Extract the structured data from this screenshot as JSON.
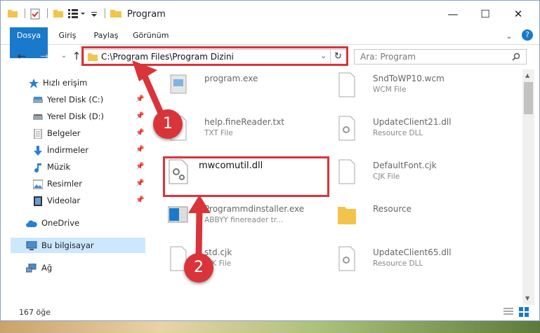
{
  "window": {
    "title": "Program",
    "controls": {
      "minimize": "—",
      "maximize": "☐",
      "close": "✕"
    }
  },
  "ribbon": {
    "tabs": [
      {
        "label": "Dosya"
      },
      {
        "label": "Giriş"
      },
      {
        "label": "Paylaş"
      },
      {
        "label": "Görünüm"
      }
    ]
  },
  "address": {
    "path": "C:\\Program Files\\Program Dizini",
    "search_placeholder": "Ara: Program"
  },
  "sidebar": {
    "items": [
      {
        "label": "Hızlı erişim",
        "icon": "star-icon",
        "pinned": false
      },
      {
        "label": "Yerel Disk (C:)",
        "icon": "drive-icon",
        "pinned": true
      },
      {
        "label": "Yerel Disk (D:)",
        "icon": "drive-icon",
        "pinned": true
      },
      {
        "label": "Belgeler",
        "icon": "document-icon",
        "pinned": true
      },
      {
        "label": "İndirmeler",
        "icon": "download-icon",
        "pinned": true
      },
      {
        "label": "Müzik",
        "icon": "music-icon",
        "pinned": true
      },
      {
        "label": "Resimler",
        "icon": "picture-icon",
        "pinned": true
      },
      {
        "label": "Videolar",
        "icon": "video-icon",
        "pinned": true
      },
      {
        "label": "OneDrive",
        "icon": "cloud-icon",
        "pinned": false
      },
      {
        "label": "Bu bilgisayar",
        "icon": "computer-icon",
        "pinned": false,
        "selected": true
      },
      {
        "label": "Ağ",
        "icon": "network-icon",
        "pinned": false
      }
    ]
  },
  "files": {
    "left": [
      {
        "name": "program.exe",
        "sub": ""
      },
      {
        "name": "help.fineReader.txt",
        "sub": "TXT File"
      },
      {
        "name": "mwcomutil.dll",
        "sub": ""
      },
      {
        "name": "Programmdinstaller.exe",
        "sub": "ABBYY finereader tr..."
      },
      {
        "name": "std.cjk",
        "sub": "CJK File"
      }
    ],
    "right": [
      {
        "name": "SndToWP10.wcm",
        "sub": "WCM File"
      },
      {
        "name": "UpdateClient21.dll",
        "sub": "Resource DLL"
      },
      {
        "name": "DefaultFont.cjk",
        "sub": "CJK File"
      },
      {
        "name": "Resource",
        "sub": ""
      },
      {
        "name": "UpdateClient65.dll",
        "sub": "Resource DLL"
      }
    ]
  },
  "status": {
    "item_count": "167 öğe"
  },
  "annotations": {
    "badge1": "1",
    "badge2": "2"
  },
  "colors": {
    "accent": "#1979ca",
    "highlight": "#d9343a",
    "selected": "#cce8ff"
  }
}
